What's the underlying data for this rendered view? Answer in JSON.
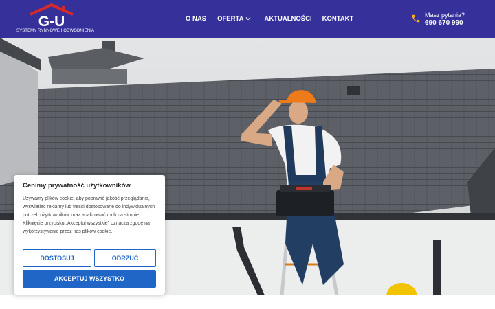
{
  "header": {
    "logo_text": "G-U",
    "tagline": "SYSTEMY RYNNOWE I ODWODNIENIA",
    "nav": [
      {
        "label": "O NAS"
      },
      {
        "label": "OFERTA"
      },
      {
        "label": "AKTUALNOŚCI"
      },
      {
        "label": "KONTAKT"
      }
    ],
    "contact_question": "Masz pytania?",
    "contact_phone": "690 670 990",
    "icons": {
      "phone": "phone-icon",
      "chevron": "chevron-down-icon"
    }
  },
  "colors": {
    "header_bg": "#35309a",
    "logo_red": "#d42a2a",
    "accent_yellow": "#f6b21b",
    "button_blue": "#1f66c7"
  },
  "cookie": {
    "title": "Cenimy prywatność użytkowników",
    "body": "Używamy plików cookie, aby poprawić jakość przeglądania, wyświetlać reklamy lub treści dostosowane do indywidualnych potrzeb użytkowników oraz analizować ruch na stronie. Kliknięcie przycisku „Akceptuj wszystkie\" oznacza zgodę na wykorzystywanie przez nas plików cookie.",
    "customize_label": "DOSTOSUJ",
    "reject_label": "ODRZUĆ",
    "accept_label": "AKCEPTUJ WSZYSTKO"
  }
}
